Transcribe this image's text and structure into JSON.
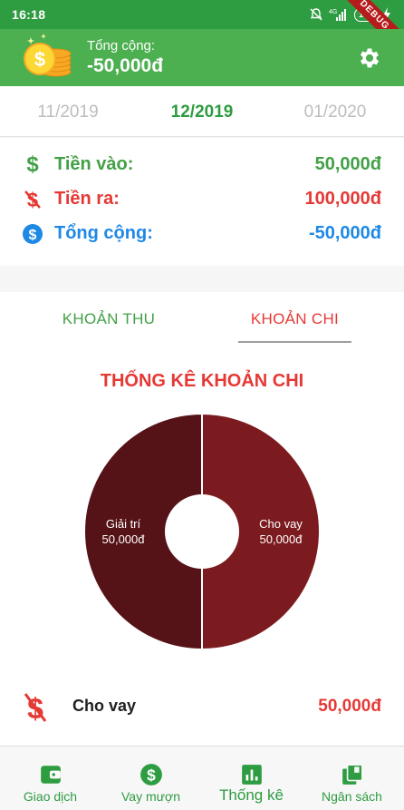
{
  "status_bar": {
    "time": "16:18",
    "network": "4G",
    "battery": "100",
    "debug_label": "DEBUG"
  },
  "header": {
    "label": "Tổng cộng:",
    "value": "-50,000đ"
  },
  "months": {
    "prev": "11/2019",
    "current": "12/2019",
    "next": "01/2020"
  },
  "summary": {
    "income": {
      "label": "Tiền vào:",
      "value": "50,000đ",
      "color": "#43a047"
    },
    "expense": {
      "label": "Tiền ra:",
      "value": "100,000đ",
      "color": "#e53935"
    },
    "total": {
      "label": "Tổng cộng:",
      "value": "-50,000đ",
      "color": "#1e88e5"
    }
  },
  "tabs": {
    "income": "KHOẢN THU",
    "expense": "KHOẢN CHI",
    "selected": "expense"
  },
  "chart_title": "THỐNG KÊ KHOẢN CHI",
  "chart_data": {
    "type": "pie",
    "donut": true,
    "slices": [
      {
        "label": "Giải trí",
        "value": 50000,
        "value_label": "50,000đ",
        "color": "#561317"
      },
      {
        "label": "Cho vay",
        "value": 50000,
        "value_label": "50,000đ",
        "color": "#7c1b1f"
      }
    ]
  },
  "list": [
    {
      "label": "Cho vay",
      "value": "50,000đ"
    }
  ],
  "bottom_nav": [
    {
      "label": "Giao dịch",
      "icon": "wallet-icon"
    },
    {
      "label": "Vay mượn",
      "icon": "dollar-circle-icon"
    },
    {
      "label": "Thống kê",
      "icon": "bar-chart-icon",
      "active": true
    },
    {
      "label": "Ngân sách",
      "icon": "cards-icon"
    }
  ],
  "colors": {
    "primary": "#4caf50",
    "primary_dark": "#2e9c41",
    "expense": "#e53935",
    "total": "#1e88e5"
  }
}
